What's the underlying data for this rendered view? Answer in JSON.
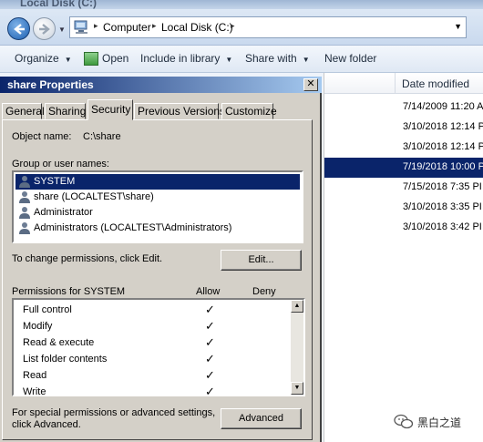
{
  "explorer": {
    "title": "Local Disk (C:)",
    "breadcrumb": [
      "Computer",
      "Local Disk (C:)"
    ],
    "toolbar": {
      "organize": "Organize",
      "open": "Open",
      "include_in_library": "Include in library",
      "share_with": "Share with",
      "new_folder": "New folder"
    },
    "columns": {
      "date_modified": "Date modified"
    },
    "files": [
      {
        "date": "7/14/2009 11:20 A"
      },
      {
        "date": "3/10/2018 12:14 P"
      },
      {
        "date": "3/10/2018 12:14 P"
      },
      {
        "date": "7/19/2018 10:00 P",
        "selected": true
      },
      {
        "date": "7/15/2018 7:35 PI"
      },
      {
        "date": "3/10/2018 3:35 PI"
      },
      {
        "date": "3/10/2018 3:42 PI"
      }
    ],
    "selection_color": "#0a246a"
  },
  "dialog": {
    "title": "share Properties",
    "close_label": "✕",
    "tabs": [
      "General",
      "Sharing",
      "Security",
      "Previous Versions",
      "Customize"
    ],
    "active_tab": "Security",
    "object_name_label": "Object name:",
    "object_name_value": "C:\\share",
    "group_label": "Group or user names:",
    "groups": [
      {
        "name": "SYSTEM",
        "selected": true
      },
      {
        "name": "share (LOCALTEST\\share)"
      },
      {
        "name": "Administrator"
      },
      {
        "name": "Administrators (LOCALTEST\\Administrators)"
      }
    ],
    "change_text": "To change permissions, click Edit.",
    "edit_button": "Edit...",
    "permissions_for": "Permissions for SYSTEM",
    "allow_header": "Allow",
    "deny_header": "Deny",
    "permissions": [
      {
        "name": "Full control",
        "allow": "✓"
      },
      {
        "name": "Modify",
        "allow": "✓"
      },
      {
        "name": "Read & execute",
        "allow": "✓"
      },
      {
        "name": "List folder contents",
        "allow": "✓"
      },
      {
        "name": "Read",
        "allow": "✓"
      },
      {
        "name": "Write",
        "allow": "✓"
      }
    ],
    "special_text_line1": "For special permissions or advanced settings,",
    "special_text_line2": "click Advanced.",
    "advanced_button": "Advanced"
  },
  "watermark": {
    "text": "黑白之道"
  }
}
